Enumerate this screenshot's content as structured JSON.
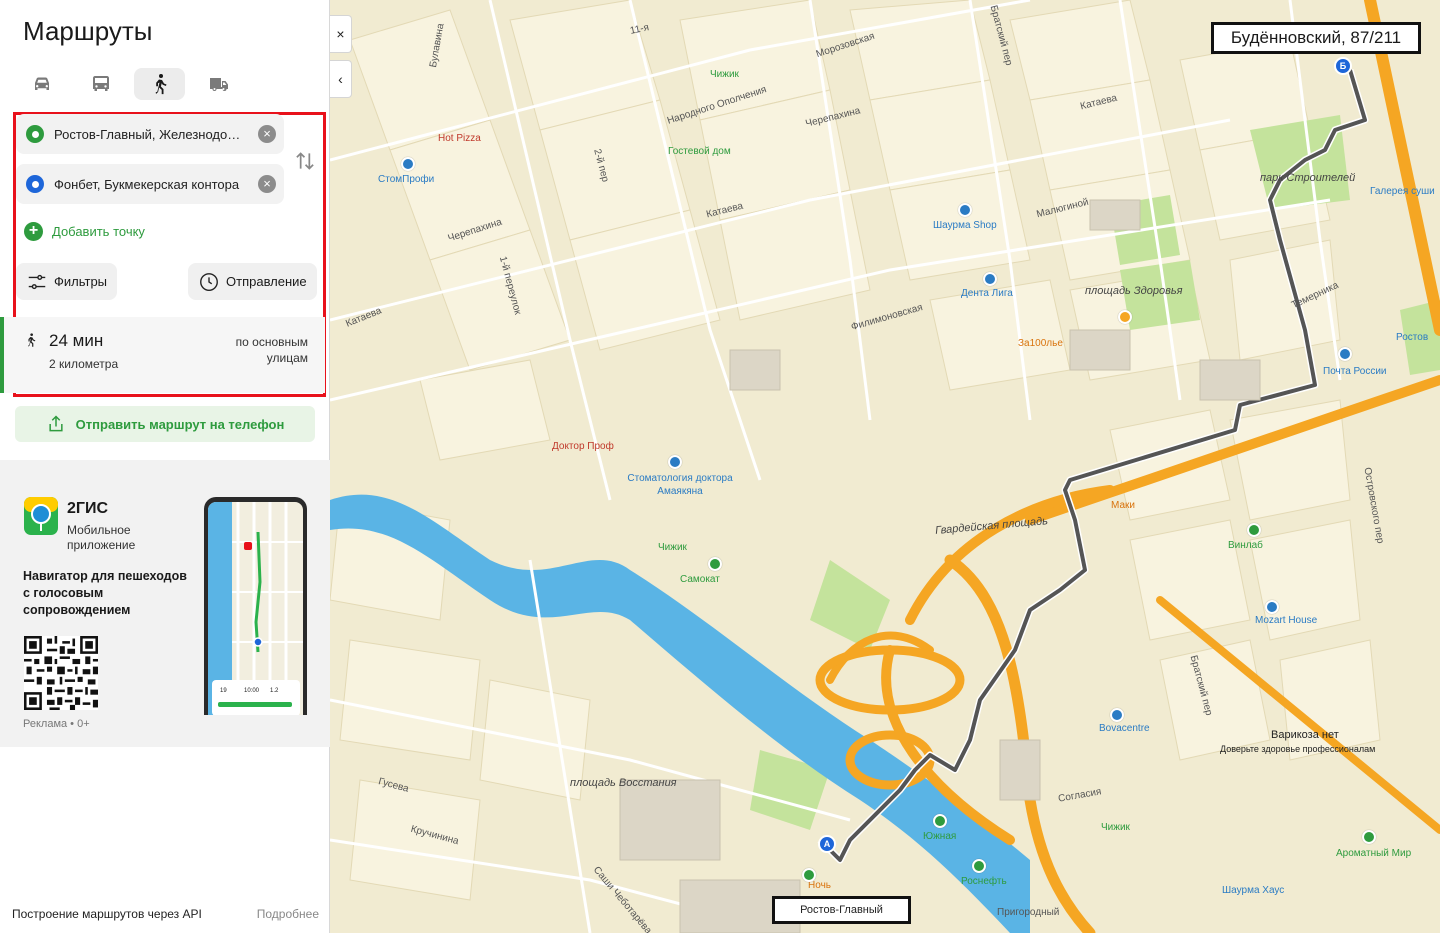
{
  "sidebar": {
    "title": "Маршруты",
    "modes": [
      {
        "name": "car",
        "icon": "car-icon"
      },
      {
        "name": "transit",
        "icon": "bus-icon"
      },
      {
        "name": "pedestrian",
        "icon": "walk-icon",
        "active": true
      },
      {
        "name": "truck",
        "icon": "truck-icon"
      }
    ],
    "from": {
      "value": "Ростов-Главный, Железнодорожный вокзал",
      "dot_color": "#2e9b3e"
    },
    "to": {
      "value": "Фонбет, Букмекерская контора",
      "dot_color": "#1e66d9"
    },
    "add_point_label": "Добавить точку",
    "filters_label": "Фильтры",
    "departure_label": "Отправление",
    "result": {
      "duration": "24 мин",
      "distance": "2 километра",
      "via": "по основным улицам"
    },
    "send_label": "Отправить маршрут на телефон",
    "promo": {
      "app_name": "2ГИС",
      "app_sub": "Мобильное приложение",
      "description": "Навигатор для пешеходов с голосовым сопровождением",
      "ad_label": "Реклама • 0+"
    },
    "footer": {
      "api_label": "Построение маршрутов через API",
      "more_label": "Подробнее"
    }
  },
  "map": {
    "close_btn": "×",
    "collapse_btn": "‹",
    "destination_label": "Будённовский, 87/211",
    "origin_label": "Ростов-Главный",
    "marker_a": "А",
    "marker_b": "Б",
    "streets": {
      "s1": "11-я",
      "s2": "Морозовская",
      "s3": "Братский пер",
      "s4": "Народного Ополчения",
      "s5": "Черепахина",
      "s6": "Катаева",
      "s7": "Малюгиной",
      "s8": "Филимоновская",
      "s9": "1-й переулок",
      "s10": "2-й пер",
      "s11": "Черепахина",
      "s12": "Катаева",
      "s13": "Катаева",
      "s14": "Темерника",
      "s15": "Островского пер",
      "s16": "Гусева",
      "s17": "Кручинина",
      "s18": "Согласия",
      "s19": "Братский пер",
      "s20": "Пригородный",
      "s21": "Булавина",
      "s22": "Саши Чеботарёва",
      "s23": "Ночь"
    },
    "squares": {
      "sq1": "площадь Здоровья",
      "sq2": "Гвардейская площадь",
      "sq3": "площадь Восстания",
      "sq4": "парк Строителей"
    },
    "pois": {
      "p1": "Hot Pizza",
      "p2": "СтомПрофи",
      "p3": "Чижик",
      "p4": "Гостевой дом",
      "p5": "Шаурма Shop",
      "p6": "Дента Лига",
      "p7": "За100лье",
      "p8": "Почта России",
      "p9": "Ростов",
      "p10": "Галерея суши",
      "p11": "Доктор Проф",
      "p12": "Стоматология доктора Амаякяна",
      "p13": "Чижик",
      "p14": "Самокат",
      "p15": "Маки",
      "p16": "Винлаб",
      "p17": "Mozart House",
      "p18": "Bovacentre",
      "p19": "Варикоза нет",
      "p20": "Доверьте здоровье профессионалам",
      "p21": "Южная",
      "p22": "Роснефть",
      "p23": "Чижик",
      "p24": "Ароматный Мир",
      "p25": "Шаурма Хаус"
    },
    "colors": {
      "route": "#555555",
      "main_road": "#f5a623",
      "water": "#5ab4e5",
      "park": "#c4e39c"
    }
  }
}
